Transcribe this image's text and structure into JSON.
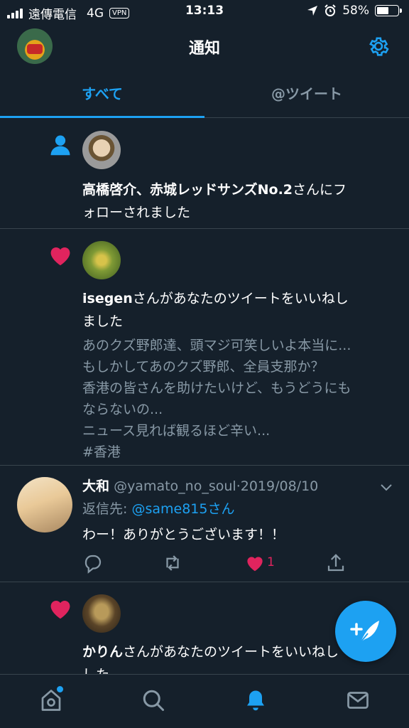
{
  "status_bar": {
    "carrier": "遠傳電信",
    "network": "4G",
    "vpn": "VPN",
    "time": "13:13",
    "battery": "58%",
    "battery_level": 0.58
  },
  "header": {
    "title": "通知"
  },
  "tabs": [
    {
      "label": "すべて",
      "active": true
    },
    {
      "label": "@ツイート",
      "active": false
    }
  ],
  "notifications": [
    {
      "type": "follow",
      "icon": "person-icon",
      "name": "高橋啓介、赤城レッドサンズNo.2",
      "line1_rest": "さんにフ",
      "line2": "ォローされました"
    },
    {
      "type": "like",
      "icon": "heart-icon",
      "name": "isegen",
      "line1_rest": "さんがあなたのツイートをいいねし",
      "line2": "ました",
      "quote": [
        "あのクズ野郎達、頭マジ可笑しいよ本当に...",
        "もしかしてあのクズ野郎、全員支那か？",
        "香港の皆さんを助けたいけど、もうどうにも",
        "ならないの...",
        "ニュース見れば観るほど辛い...",
        "#香港"
      ]
    },
    {
      "type": "like",
      "icon": "heart-icon",
      "name": "かりん",
      "line1_rest": "さんがあなたのツイートをいいね",
      "line1_tail": "し",
      "line2": "した"
    }
  ],
  "tweet": {
    "name": "大和",
    "handle": "@yamato_no_soul",
    "separator": "·",
    "date": "2019/08/10",
    "reply_prefix": "返信先: ",
    "reply_to": "@same815さん",
    "body": "わー！ありがとうございます！！",
    "like_count": "1"
  },
  "colors": {
    "background": "#15202b",
    "accent": "#1da1f2",
    "like": "#e0245e",
    "secondary_text": "#8899a6",
    "divider": "#38444d"
  },
  "bottom_nav": [
    {
      "name": "home-icon"
    },
    {
      "name": "search-icon"
    },
    {
      "name": "notifications-icon",
      "active": true
    },
    {
      "name": "messages-icon"
    }
  ]
}
